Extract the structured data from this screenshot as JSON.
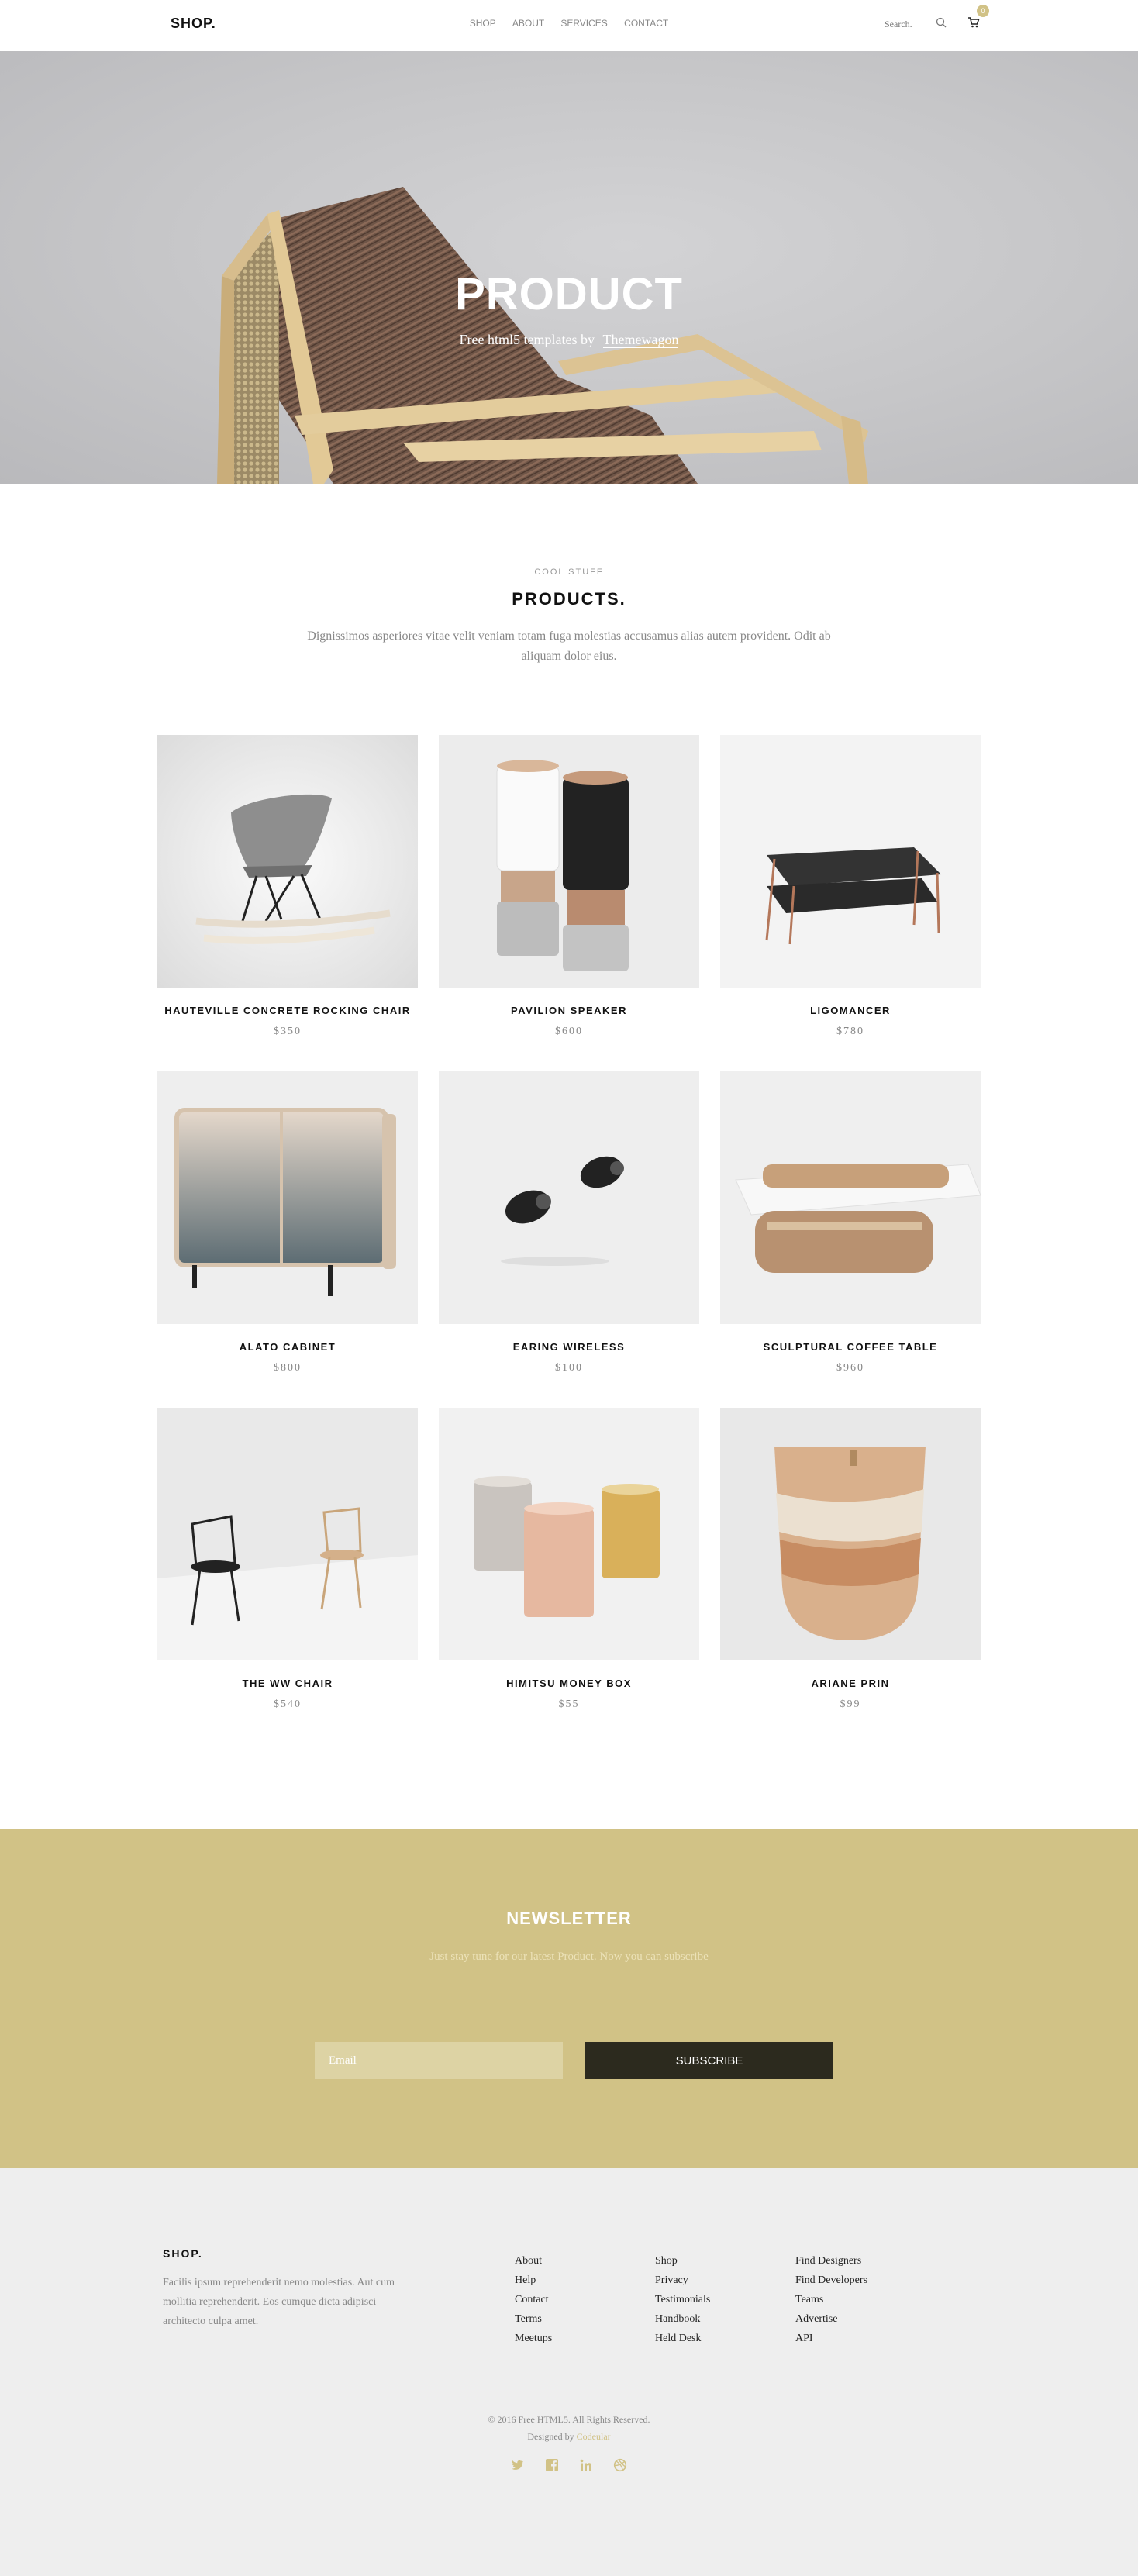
{
  "nav": {
    "logo": "SHOP.",
    "menu": [
      "SHOP",
      "ABOUT",
      "SERVICES",
      "CONTACT"
    ],
    "search_placeholder": "Search.",
    "cart_count": "0"
  },
  "hero": {
    "title": "PRODUCT",
    "subtitle": "Free html5 templates by",
    "link": "Themewagon"
  },
  "products_section": {
    "eyebrow": "COOL STUFF",
    "title": "PRODUCTS.",
    "description": "Dignissimos asperiores vitae velit veniam totam fuga molestias accusamus alias autem provident. Odit ab aliquam dolor eius."
  },
  "products": [
    {
      "name": "HAUTEVILLE CONCRETE ROCKING CHAIR",
      "price": "$350"
    },
    {
      "name": "PAVILION SPEAKER",
      "price": "$600"
    },
    {
      "name": "LIGOMANCER",
      "price": "$780"
    },
    {
      "name": "ALATO CABINET",
      "price": "$800"
    },
    {
      "name": "EARING WIRELESS",
      "price": "$100"
    },
    {
      "name": "SCULPTURAL COFFEE TABLE",
      "price": "$960"
    },
    {
      "name": "THE WW CHAIR",
      "price": "$540"
    },
    {
      "name": "HIMITSU MONEY BOX",
      "price": "$55"
    },
    {
      "name": "ARIANE PRIN",
      "price": "$99"
    }
  ],
  "newsletter": {
    "title": "NEWSLETTER",
    "subtitle": "Just stay tune for our latest Product. Now you can subscribe",
    "email_placeholder": "Email",
    "button": "SUBSCRIBE"
  },
  "footer": {
    "logo": "SHOP.",
    "description": "Facilis ipsum reprehenderit nemo molestias. Aut cum mollitia reprehenderit. Eos cumque dicta adipisci architecto culpa amet.",
    "columns": [
      [
        "About",
        "Help",
        "Contact",
        "Terms",
        "Meetups"
      ],
      [
        "Shop",
        "Privacy",
        "Testimonials",
        "Handbook",
        "Held Desk"
      ],
      [
        "Find Designers",
        "Find Developers",
        "Teams",
        "Advertise",
        "API"
      ]
    ],
    "copyright": "© 2016 Free HTML5. All Rights Reserved.",
    "designed_by": "Designed by",
    "designer": "Codeular"
  },
  "colors": {
    "accent": "#d1c286",
    "dark_button": "#2c2a1e",
    "footer_bg": "#eeeeee"
  },
  "icons": {
    "search": "search-icon",
    "cart": "cart-icon",
    "socials": [
      "twitter-icon",
      "facebook-icon",
      "linkedin-icon",
      "dribbble-icon"
    ]
  }
}
